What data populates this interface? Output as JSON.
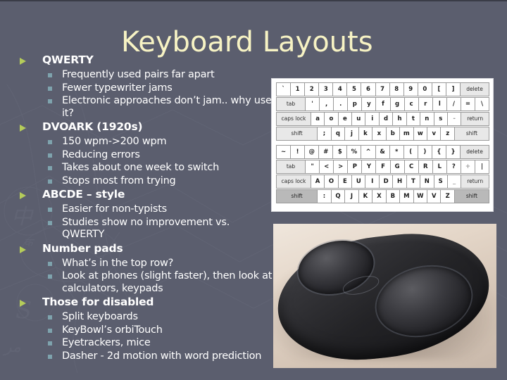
{
  "slide": {
    "title": "Keyboard Layouts",
    "background_color": "#5b5e6e",
    "title_color": "#f7f3c4",
    "bullet1_color": "#b5cc5a",
    "bullet2_color": "#7ea3ad",
    "text_color": "#ffffff"
  },
  "outline": [
    {
      "label": "QWERTY",
      "sub": [
        "Frequently used pairs far apart",
        "Fewer typewriter jams",
        "Electronic approaches don’t jam.. why use it?"
      ]
    },
    {
      "label": "DVOARK (1920s)",
      "sub": [
        "150 wpm->200 wpm",
        "Reducing errors",
        "Takes about one week to switch",
        "Stops most from trying"
      ]
    },
    {
      "label": "ABCDE – style",
      "sub": [
        "Easier for non-typists",
        "Studies show no improvement vs. QWERTY"
      ]
    },
    {
      "label": "Number pads",
      "sub": [
        "What’s in the top row?",
        "Look at phones (slight faster), then look at calculators, keypads"
      ]
    },
    {
      "label": "Those for disabled",
      "sub": [
        "Split keyboards",
        "KeyBowl’s orbiTouch",
        "Eyetrackers, mice",
        "Dasher - 2d motion with word prediction"
      ]
    }
  ],
  "keyboard_graphic": {
    "caption": "dvorak-keyboard-layout-image",
    "unshifted": {
      "row1": [
        "`",
        "1",
        "2",
        "3",
        "4",
        "5",
        "6",
        "7",
        "8",
        "9",
        "0",
        "[",
        "]",
        "delete"
      ],
      "row2": [
        "tab",
        "'",
        ",",
        ".",
        "p",
        "y",
        "f",
        "g",
        "c",
        "r",
        "l",
        "/",
        "=",
        "\\"
      ],
      "row3": [
        "caps lock",
        "a",
        "o",
        "e",
        "u",
        "i",
        "d",
        "h",
        "t",
        "n",
        "s",
        "-",
        "return"
      ],
      "row4": [
        "shift",
        ";",
        "q",
        "j",
        "k",
        "x",
        "b",
        "m",
        "w",
        "v",
        "z",
        "shift"
      ]
    },
    "shifted": {
      "row1": [
        "~",
        "!",
        "@",
        "#",
        "$",
        "%",
        "^",
        "&",
        "*",
        "(",
        ")",
        "{",
        "}",
        "delete"
      ],
      "row2": [
        "tab",
        "\"",
        "<",
        ">",
        "P",
        "Y",
        "F",
        "G",
        "C",
        "R",
        "L",
        "?",
        "+",
        "|"
      ],
      "row3": [
        "caps lock",
        "A",
        "O",
        "E",
        "U",
        "I",
        "D",
        "H",
        "T",
        "N",
        "S",
        "_",
        "return"
      ],
      "row4": [
        "shift",
        ":",
        "Q",
        "J",
        "K",
        "X",
        "B",
        "M",
        "W",
        "V",
        "Z",
        "shift"
      ]
    }
  },
  "photo": {
    "caption": "orbitouch-keyless-keyboard-photo"
  }
}
